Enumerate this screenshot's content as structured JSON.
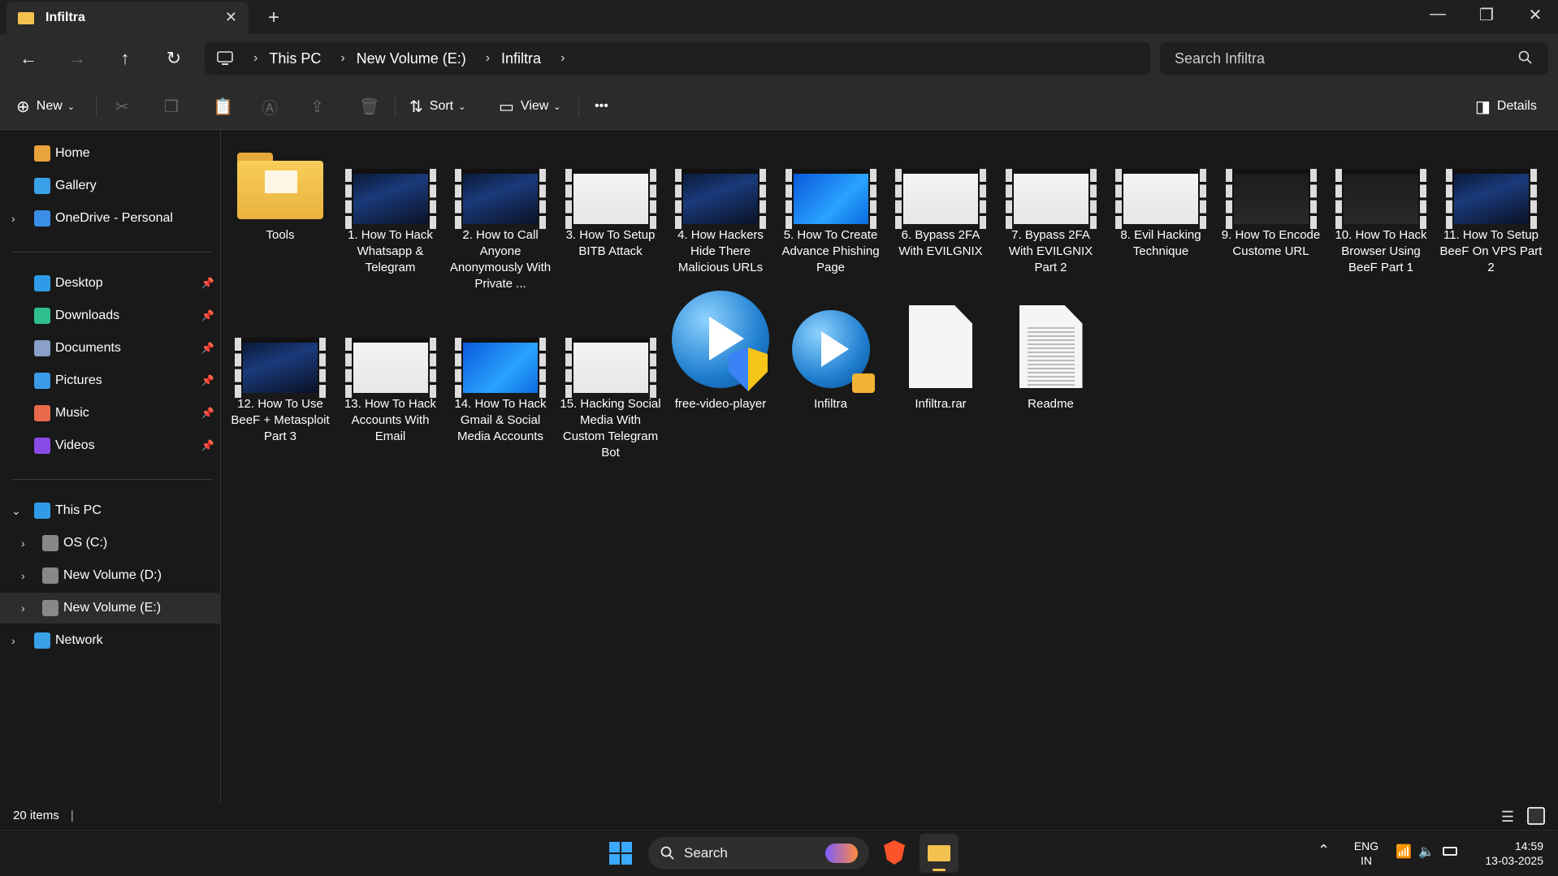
{
  "window": {
    "tab_title": "Infiltra",
    "new_tab": "+",
    "close_tab": "✕",
    "minimize": "—",
    "restore": "❐",
    "close": "✕"
  },
  "nav": {
    "back": "←",
    "forward": "→",
    "up": "↑",
    "refresh": "↻",
    "breadcrumb": [
      "This PC",
      "New Volume (E:)",
      "Infiltra"
    ],
    "search_placeholder": "Search Infiltra"
  },
  "toolbar": {
    "new_label": "New",
    "sort_label": "Sort",
    "view_label": "View",
    "more_label": "•••",
    "details_label": "Details"
  },
  "sidebar": {
    "top": [
      {
        "label": "Home",
        "color": "#e8a33a"
      },
      {
        "label": "Gallery",
        "color": "#3aa0e8"
      },
      {
        "label": "OneDrive - Personal",
        "color": "#3a8ee8"
      }
    ],
    "pinned": [
      {
        "label": "Desktop",
        "color": "#2f9be8"
      },
      {
        "label": "Downloads",
        "color": "#2fbf8f"
      },
      {
        "label": "Documents",
        "color": "#8aa0c8"
      },
      {
        "label": "Pictures",
        "color": "#3a9be8"
      },
      {
        "label": "Music",
        "color": "#e86a4a"
      },
      {
        "label": "Videos",
        "color": "#8a4ae8"
      }
    ],
    "pin_glyph": "📌",
    "this_pc": "This PC",
    "drives": [
      "OS (C:)",
      "New Volume (D:)",
      "New Volume (E:)"
    ],
    "network": "Network"
  },
  "files": [
    {
      "name": "Tools",
      "kind": "folder"
    },
    {
      "name": "1. How To Hack Whatsapp & Telegram",
      "kind": "video",
      "thumb": "night"
    },
    {
      "name": "2. How to Call Anyone Anonymously With Private ...",
      "kind": "video",
      "thumb": "night"
    },
    {
      "name": "3. How To Setup BITB Attack",
      "kind": "video",
      "thumb": "white"
    },
    {
      "name": "4. How Hackers Hide There Malicious URLs",
      "kind": "video",
      "thumb": "night"
    },
    {
      "name": "5. How To Create Advance Phishing Page",
      "kind": "video",
      "thumb": "blue"
    },
    {
      "name": "6. Bypass 2FA With EVILGNIX",
      "kind": "video",
      "thumb": "white"
    },
    {
      "name": "7. Bypass 2FA With EVILGNIX Part 2",
      "kind": "video",
      "thumb": "white"
    },
    {
      "name": "8. Evil Hacking Technique",
      "kind": "video",
      "thumb": "white"
    },
    {
      "name": "9. How To Encode Custome URL",
      "kind": "video",
      "thumb": "dark"
    },
    {
      "name": "10. How To Hack Browser Using BeeF Part 1",
      "kind": "video",
      "thumb": "dark"
    },
    {
      "name": "11. How To Setup BeeF On VPS Part 2",
      "kind": "video",
      "thumb": "night"
    },
    {
      "name": "12. How To Use BeeF + Metasploit Part 3",
      "kind": "video",
      "thumb": "night"
    },
    {
      "name": "13. How To Hack Accounts With Email",
      "kind": "video",
      "thumb": "white"
    },
    {
      "name": "14. How To Hack Gmail & Social Media Accounts",
      "kind": "video",
      "thumb": "blue"
    },
    {
      "name": "15. Hacking Social Media With Custom Telegram Bot",
      "kind": "video",
      "thumb": "white"
    },
    {
      "name": "free-video-player",
      "kind": "player"
    },
    {
      "name": "Infiltra",
      "kind": "player-lock"
    },
    {
      "name": "Infiltra.rar",
      "kind": "blank"
    },
    {
      "name": "Readme",
      "kind": "text"
    }
  ],
  "status": {
    "count": "20 items"
  },
  "taskbar": {
    "search_label": "Search",
    "lang": "ENG",
    "region": "IN",
    "time": "14:59",
    "date": "13-03-2025"
  }
}
